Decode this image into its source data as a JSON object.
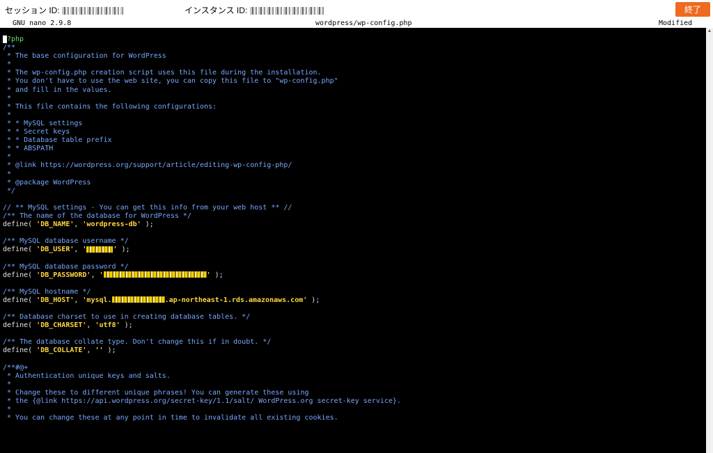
{
  "header": {
    "session_label": "セッション ID:",
    "instance_label": "インスタンス ID:",
    "end_button": "終了"
  },
  "nano": {
    "version": "GNU nano 2.9.8",
    "filename": "wordpress/wp-config.php",
    "status": "Modified"
  },
  "lines": {
    "l1": "?php",
    "l2": "/**",
    "l3": " * The base configuration for WordPress",
    "l4": " *",
    "l5": " * The wp-config.php creation script uses this file during the installation.",
    "l6": " * You don't have to use the web site, you can copy this file to \"wp-config.php\"",
    "l7": " * and fill in the values.",
    "l8": " *",
    "l9": " * This file contains the following configurations:",
    "l10": " *",
    "l11": " * * MySQL settings",
    "l12": " * * Secret keys",
    "l13": " * * Database table prefix",
    "l14": " * * ABSPATH",
    "l15": " *",
    "l16": " * @link https://wordpress.org/support/article/editing-wp-config-php/",
    "l17": " *",
    "l18": " * @package WordPress",
    "l19": " */",
    "l21": "// ** MySQL settings - You can get this info from your web host ** //",
    "l22": "/** The name of the database for WordPress */",
    "l23a": "define( ",
    "l23b": "'DB_NAME'",
    "l23c": ", ",
    "l23d": "'wordpress-db'",
    "l23e": " );",
    "l25": "/** MySQL database username */",
    "l26a": "define( ",
    "l26b": "'DB_USER'",
    "l26c": ", ",
    "l26d": "'",
    "l26e": "'",
    "l26f": " );",
    "l28": "/** MySQL database password */",
    "l29a": "define( ",
    "l29b": "'DB_PASSWORD'",
    "l29c": ", ",
    "l29d": "'",
    "l29e": "'",
    "l29f": " );",
    "l31": "/** MySQL hostname */",
    "l32a": "define( ",
    "l32b": "'DB_HOST'",
    "l32c": ", ",
    "l32d": "'mysql.",
    "l32e": ".ap-northeast-1.rds.amazonaws.com'",
    "l32f": " );",
    "l34": "/** Database charset to use in creating database tables. */",
    "l35a": "define( ",
    "l35b": "'DB_CHARSET'",
    "l35c": ", ",
    "l35d": "'utf8'",
    "l35e": " );",
    "l37": "/** The database collate type. Don't change this if in doubt. */",
    "l38a": "define( ",
    "l38b": "'DB_COLLATE'",
    "l38c": ", ",
    "l38d": "''",
    "l38e": " );",
    "l40": "/**#@+",
    "l41": " * Authentication unique keys and salts.",
    "l42": " *",
    "l43": " * Change these to different unique phrases! You can generate these using",
    "l44": " * the {@link https://api.wordpress.org/secret-key/1.1/salt/ WordPress.org secret-key service}.",
    "l45": " *",
    "l46": " * You can change these at any point in time to invalidate all existing cookies."
  }
}
